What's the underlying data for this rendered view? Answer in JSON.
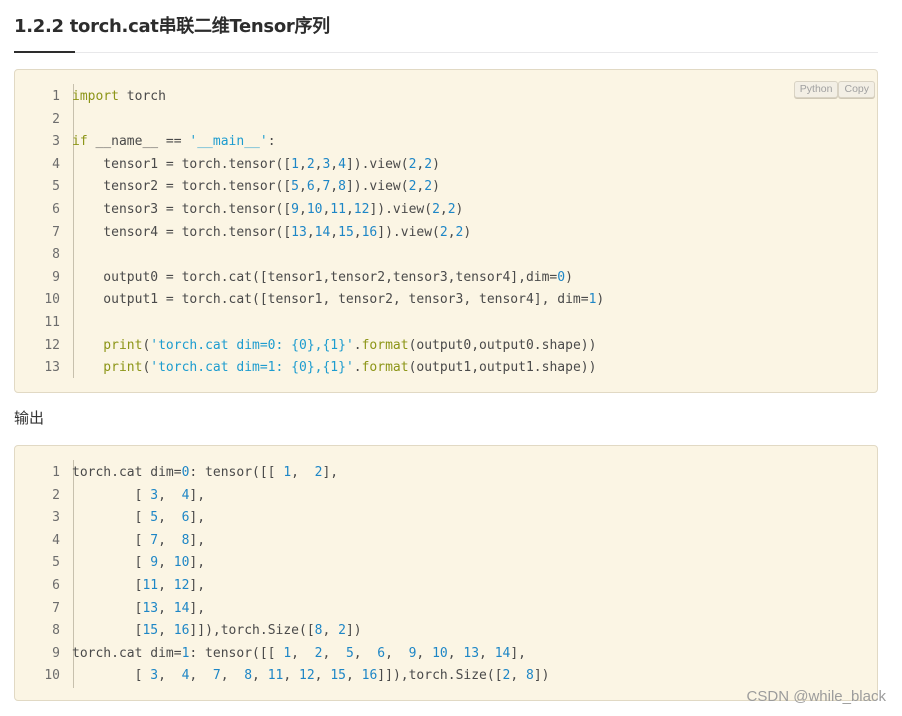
{
  "heading": "1.2.2 torch.cat串联二维Tensor序列",
  "output_label": "输出",
  "watermark": "CSDN @while_black",
  "code_block": {
    "language_badge": "Python",
    "copy_badge": "Copy",
    "line_numbers": [
      "1",
      "2",
      "3",
      "4",
      "5",
      "6",
      "7",
      "8",
      "9",
      "10",
      "11",
      "12",
      "13"
    ],
    "lines": [
      [
        {
          "t": "import",
          "c": "kw"
        },
        {
          "t": " torch",
          "c": ""
        }
      ],
      [],
      [
        {
          "t": "if",
          "c": "kw"
        },
        {
          "t": " __name__ == ",
          "c": ""
        },
        {
          "t": "'__main__'",
          "c": "str"
        },
        {
          "t": ":",
          "c": ""
        }
      ],
      [
        {
          "t": "    tensor1 = torch.tensor([",
          "c": ""
        },
        {
          "t": "1",
          "c": "num"
        },
        {
          "t": ",",
          "c": ""
        },
        {
          "t": "2",
          "c": "num"
        },
        {
          "t": ",",
          "c": ""
        },
        {
          "t": "3",
          "c": "num"
        },
        {
          "t": ",",
          "c": ""
        },
        {
          "t": "4",
          "c": "num"
        },
        {
          "t": "]).view(",
          "c": ""
        },
        {
          "t": "2",
          "c": "num"
        },
        {
          "t": ",",
          "c": ""
        },
        {
          "t": "2",
          "c": "num"
        },
        {
          "t": ")",
          "c": ""
        }
      ],
      [
        {
          "t": "    tensor2 = torch.tensor([",
          "c": ""
        },
        {
          "t": "5",
          "c": "num"
        },
        {
          "t": ",",
          "c": ""
        },
        {
          "t": "6",
          "c": "num"
        },
        {
          "t": ",",
          "c": ""
        },
        {
          "t": "7",
          "c": "num"
        },
        {
          "t": ",",
          "c": ""
        },
        {
          "t": "8",
          "c": "num"
        },
        {
          "t": "]).view(",
          "c": ""
        },
        {
          "t": "2",
          "c": "num"
        },
        {
          "t": ",",
          "c": ""
        },
        {
          "t": "2",
          "c": "num"
        },
        {
          "t": ")",
          "c": ""
        }
      ],
      [
        {
          "t": "    tensor3 = torch.tensor([",
          "c": ""
        },
        {
          "t": "9",
          "c": "num"
        },
        {
          "t": ",",
          "c": ""
        },
        {
          "t": "10",
          "c": "num"
        },
        {
          "t": ",",
          "c": ""
        },
        {
          "t": "11",
          "c": "num"
        },
        {
          "t": ",",
          "c": ""
        },
        {
          "t": "12",
          "c": "num"
        },
        {
          "t": "]).view(",
          "c": ""
        },
        {
          "t": "2",
          "c": "num"
        },
        {
          "t": ",",
          "c": ""
        },
        {
          "t": "2",
          "c": "num"
        },
        {
          "t": ")",
          "c": ""
        }
      ],
      [
        {
          "t": "    tensor4 = torch.tensor([",
          "c": ""
        },
        {
          "t": "13",
          "c": "num"
        },
        {
          "t": ",",
          "c": ""
        },
        {
          "t": "14",
          "c": "num"
        },
        {
          "t": ",",
          "c": ""
        },
        {
          "t": "15",
          "c": "num"
        },
        {
          "t": ",",
          "c": ""
        },
        {
          "t": "16",
          "c": "num"
        },
        {
          "t": "]).view(",
          "c": ""
        },
        {
          "t": "2",
          "c": "num"
        },
        {
          "t": ",",
          "c": ""
        },
        {
          "t": "2",
          "c": "num"
        },
        {
          "t": ")",
          "c": ""
        }
      ],
      [],
      [
        {
          "t": "    output0 = torch.cat([tensor1,tensor2,tensor3,tensor4],dim=",
          "c": ""
        },
        {
          "t": "0",
          "c": "num"
        },
        {
          "t": ")",
          "c": ""
        }
      ],
      [
        {
          "t": "    output1 = torch.cat([tensor1, tensor2, tensor3, tensor4], dim=",
          "c": ""
        },
        {
          "t": "1",
          "c": "num"
        },
        {
          "t": ")",
          "c": ""
        }
      ],
      [],
      [
        {
          "t": "    print",
          "c": "kw"
        },
        {
          "t": "(",
          "c": ""
        },
        {
          "t": "'torch.cat dim=0: {0},{1}'",
          "c": "str"
        },
        {
          "t": ".",
          "c": ""
        },
        {
          "t": "format",
          "c": "kw"
        },
        {
          "t": "(output0,output0.shape))",
          "c": ""
        }
      ],
      [
        {
          "t": "    print",
          "c": "kw"
        },
        {
          "t": "(",
          "c": ""
        },
        {
          "t": "'torch.cat dim=1: {0},{1}'",
          "c": "str"
        },
        {
          "t": ".",
          "c": ""
        },
        {
          "t": "format",
          "c": "kw"
        },
        {
          "t": "(output1,output1.shape))",
          "c": ""
        }
      ]
    ]
  },
  "output_block": {
    "line_numbers": [
      "1",
      "2",
      "3",
      "4",
      "5",
      "6",
      "7",
      "8",
      "9",
      "10"
    ],
    "lines": [
      [
        {
          "t": "torch.cat dim=",
          "c": ""
        },
        {
          "t": "0",
          "c": "num"
        },
        {
          "t": ": tensor([[ ",
          "c": ""
        },
        {
          "t": "1",
          "c": "num"
        },
        {
          "t": ",  ",
          "c": ""
        },
        {
          "t": "2",
          "c": "num"
        },
        {
          "t": "],",
          "c": ""
        }
      ],
      [
        {
          "t": "        [ ",
          "c": ""
        },
        {
          "t": "3",
          "c": "num"
        },
        {
          "t": ",  ",
          "c": ""
        },
        {
          "t": "4",
          "c": "num"
        },
        {
          "t": "],",
          "c": ""
        }
      ],
      [
        {
          "t": "        [ ",
          "c": ""
        },
        {
          "t": "5",
          "c": "num"
        },
        {
          "t": ",  ",
          "c": ""
        },
        {
          "t": "6",
          "c": "num"
        },
        {
          "t": "],",
          "c": ""
        }
      ],
      [
        {
          "t": "        [ ",
          "c": ""
        },
        {
          "t": "7",
          "c": "num"
        },
        {
          "t": ",  ",
          "c": ""
        },
        {
          "t": "8",
          "c": "num"
        },
        {
          "t": "],",
          "c": ""
        }
      ],
      [
        {
          "t": "        [ ",
          "c": ""
        },
        {
          "t": "9",
          "c": "num"
        },
        {
          "t": ", ",
          "c": ""
        },
        {
          "t": "10",
          "c": "num"
        },
        {
          "t": "],",
          "c": ""
        }
      ],
      [
        {
          "t": "        [",
          "c": ""
        },
        {
          "t": "11",
          "c": "num"
        },
        {
          "t": ", ",
          "c": ""
        },
        {
          "t": "12",
          "c": "num"
        },
        {
          "t": "],",
          "c": ""
        }
      ],
      [
        {
          "t": "        [",
          "c": ""
        },
        {
          "t": "13",
          "c": "num"
        },
        {
          "t": ", ",
          "c": ""
        },
        {
          "t": "14",
          "c": "num"
        },
        {
          "t": "],",
          "c": ""
        }
      ],
      [
        {
          "t": "        [",
          "c": ""
        },
        {
          "t": "15",
          "c": "num"
        },
        {
          "t": ", ",
          "c": ""
        },
        {
          "t": "16",
          "c": "num"
        },
        {
          "t": "]]),torch.Size([",
          "c": ""
        },
        {
          "t": "8",
          "c": "num"
        },
        {
          "t": ", ",
          "c": ""
        },
        {
          "t": "2",
          "c": "num"
        },
        {
          "t": "])",
          "c": ""
        }
      ],
      [
        {
          "t": "torch.cat dim=",
          "c": ""
        },
        {
          "t": "1",
          "c": "num"
        },
        {
          "t": ": tensor([[ ",
          "c": ""
        },
        {
          "t": "1",
          "c": "num"
        },
        {
          "t": ",  ",
          "c": ""
        },
        {
          "t": "2",
          "c": "num"
        },
        {
          "t": ",  ",
          "c": ""
        },
        {
          "t": "5",
          "c": "num"
        },
        {
          "t": ",  ",
          "c": ""
        },
        {
          "t": "6",
          "c": "num"
        },
        {
          "t": ",  ",
          "c": ""
        },
        {
          "t": "9",
          "c": "num"
        },
        {
          "t": ", ",
          "c": ""
        },
        {
          "t": "10",
          "c": "num"
        },
        {
          "t": ", ",
          "c": ""
        },
        {
          "t": "13",
          "c": "num"
        },
        {
          "t": ", ",
          "c": ""
        },
        {
          "t": "14",
          "c": "num"
        },
        {
          "t": "],",
          "c": ""
        }
      ],
      [
        {
          "t": "        [ ",
          "c": ""
        },
        {
          "t": "3",
          "c": "num"
        },
        {
          "t": ",  ",
          "c": ""
        },
        {
          "t": "4",
          "c": "num"
        },
        {
          "t": ",  ",
          "c": ""
        },
        {
          "t": "7",
          "c": "num"
        },
        {
          "t": ",  ",
          "c": ""
        },
        {
          "t": "8",
          "c": "num"
        },
        {
          "t": ", ",
          "c": ""
        },
        {
          "t": "11",
          "c": "num"
        },
        {
          "t": ", ",
          "c": ""
        },
        {
          "t": "12",
          "c": "num"
        },
        {
          "t": ", ",
          "c": ""
        },
        {
          "t": "15",
          "c": "num"
        },
        {
          "t": ", ",
          "c": ""
        },
        {
          "t": "16",
          "c": "num"
        },
        {
          "t": "]]),torch.Size([",
          "c": ""
        },
        {
          "t": "2",
          "c": "num"
        },
        {
          "t": ", ",
          "c": ""
        },
        {
          "t": "8",
          "c": "num"
        },
        {
          "t": "])",
          "c": ""
        }
      ]
    ]
  }
}
